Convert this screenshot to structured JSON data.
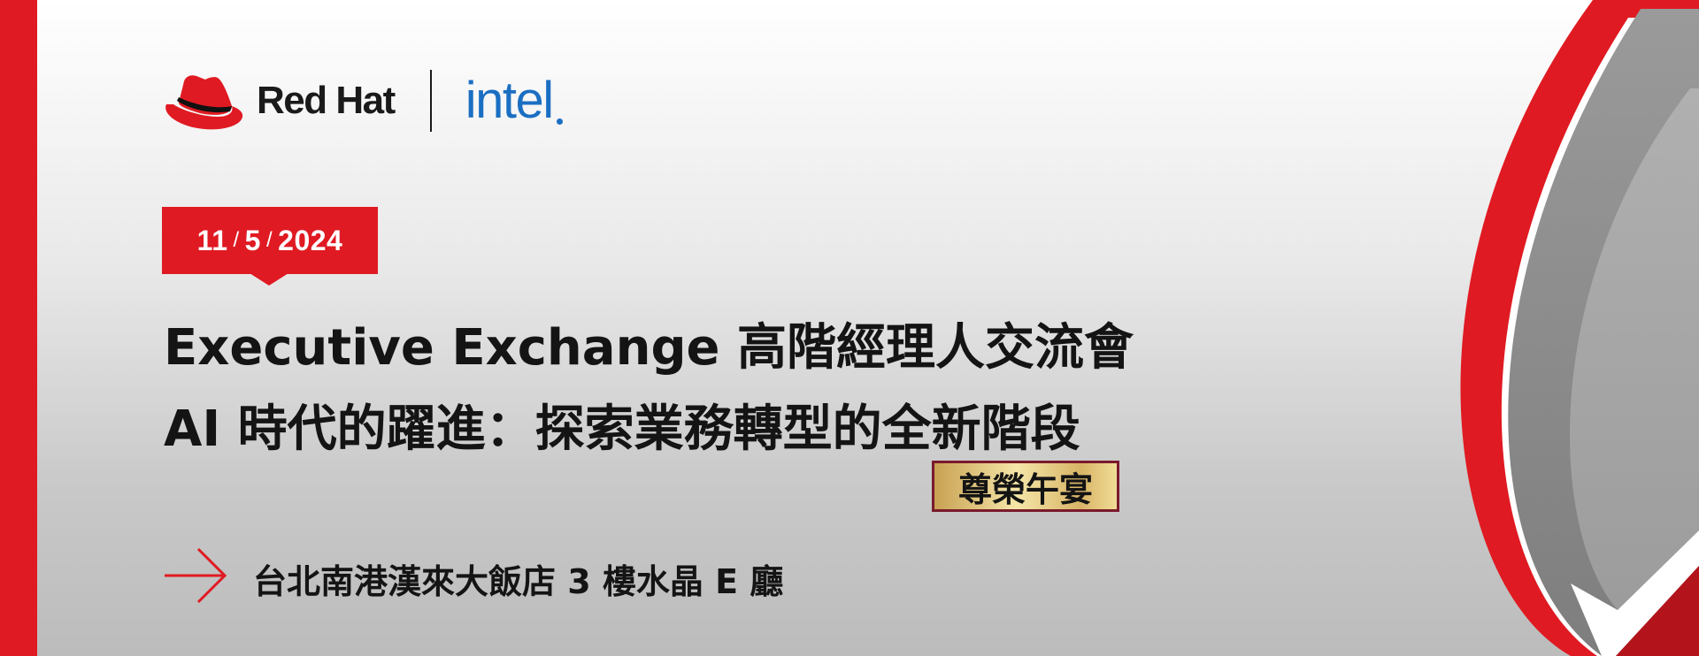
{
  "brand": {
    "redhat_name": "Red Hat",
    "intel_name": "intel"
  },
  "event": {
    "date_month": "11",
    "date_day": "5",
    "date_year": "2024",
    "date_separator": "/",
    "title_line1": "Executive Exchange 高階經理人交流會",
    "title_line2": "AI 時代的躍進：探索業務轉型的全新階段",
    "tag": "尊榮午宴",
    "venue": "台北南港漢來大飯店 3 樓水晶 E 廳"
  },
  "icons": {
    "venue_arrow": "arrow-right-icon",
    "redhat_logo": "red-hat-fedora-icon"
  },
  "colors": {
    "brand_red": "#e01a22",
    "intel_blue": "#1b6fc2",
    "gold": "#d8b466",
    "tag_border": "#7a1a2c"
  }
}
